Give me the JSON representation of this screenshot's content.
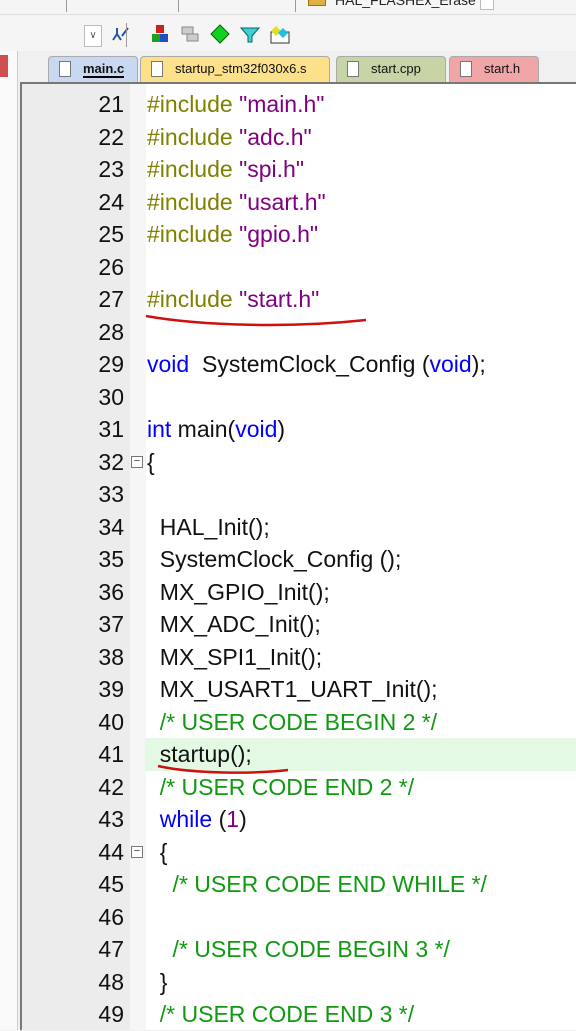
{
  "toolbar": {
    "function_select": "HAL_FLASHEx_Erase"
  },
  "tabs": [
    {
      "label": "main.c",
      "color": "#c8d8f0",
      "active": true
    },
    {
      "label": "startup_stm32f030x6.s",
      "color": "#fde08a"
    },
    {
      "label": "start.cpp",
      "color": "#c6d4a6"
    },
    {
      "label": "start.h",
      "color": "#f0a6a6"
    }
  ],
  "lines": [
    {
      "n": "21",
      "t": [
        [
          "pp",
          "#include "
        ],
        [
          "st",
          "\"main.h\""
        ]
      ]
    },
    {
      "n": "22",
      "t": [
        [
          "pp",
          "#include "
        ],
        [
          "st",
          "\"adc.h\""
        ]
      ]
    },
    {
      "n": "23",
      "t": [
        [
          "pp",
          "#include "
        ],
        [
          "st",
          "\"spi.h\""
        ]
      ]
    },
    {
      "n": "24",
      "t": [
        [
          "pp",
          "#include "
        ],
        [
          "st",
          "\"usart.h\""
        ]
      ]
    },
    {
      "n": "25",
      "t": [
        [
          "pp",
          "#include "
        ],
        [
          "st",
          "\"gpio.h\""
        ]
      ]
    },
    {
      "n": "26",
      "t": []
    },
    {
      "n": "27",
      "t": [
        [
          "pp",
          "#include "
        ],
        [
          "st",
          "\"start.h\""
        ]
      ]
    },
    {
      "n": "28",
      "t": []
    },
    {
      "n": "29",
      "t": [
        [
          "kw",
          "void"
        ],
        [
          "",
          "  SystemClock_Config ("
        ],
        [
          "kw",
          "void"
        ],
        [
          "",
          ");"
        ]
      ]
    },
    {
      "n": "30",
      "t": []
    },
    {
      "n": "31",
      "t": [
        [
          "kw",
          "int"
        ],
        [
          "",
          " main("
        ],
        [
          "kw",
          "void"
        ],
        [
          "",
          ")"
        ]
      ]
    },
    {
      "n": "32",
      "t": [
        [
          "",
          "{"
        ]
      ],
      "fold": "−"
    },
    {
      "n": "33",
      "t": []
    },
    {
      "n": "34",
      "t": [
        [
          "",
          "  HAL_Init();"
        ]
      ]
    },
    {
      "n": "35",
      "t": [
        [
          "",
          "  SystemClock_Config ();"
        ]
      ]
    },
    {
      "n": "36",
      "t": [
        [
          "",
          "  MX_GPIO_Init();"
        ]
      ]
    },
    {
      "n": "37",
      "t": [
        [
          "",
          "  MX_ADC_Init();"
        ]
      ]
    },
    {
      "n": "38",
      "t": [
        [
          "",
          "  MX_SPI1_Init();"
        ]
      ]
    },
    {
      "n": "39",
      "t": [
        [
          "",
          "  MX_USART1_UART_Init();"
        ]
      ]
    },
    {
      "n": "40",
      "t": [
        [
          "cm",
          "  /* USER CODE BEGIN 2 */"
        ]
      ]
    },
    {
      "n": "41",
      "t": [
        [
          "",
          "  startup();"
        ]
      ],
      "hl": true
    },
    {
      "n": "42",
      "t": [
        [
          "cm",
          "  /* USER CODE END 2 */"
        ]
      ]
    },
    {
      "n": "43",
      "t": [
        [
          "kw",
          "  while"
        ],
        [
          "",
          " ("
        ],
        [
          "nm",
          "1"
        ],
        [
          "",
          ")"
        ]
      ]
    },
    {
      "n": "44",
      "t": [
        [
          "",
          "  {"
        ]
      ],
      "fold": "−"
    },
    {
      "n": "45",
      "t": [
        [
          "cm",
          "    /* USER CODE END WHILE */"
        ]
      ]
    },
    {
      "n": "46",
      "t": []
    },
    {
      "n": "47",
      "t": [
        [
          "cm",
          "    /* USER CODE BEGIN 3 */"
        ]
      ]
    },
    {
      "n": "48",
      "t": [
        [
          "",
          "  }"
        ]
      ]
    },
    {
      "n": "49",
      "t": [
        [
          "cm",
          "  /* USER CODE END 3 */"
        ]
      ]
    }
  ],
  "annotation_color": "#d01010"
}
